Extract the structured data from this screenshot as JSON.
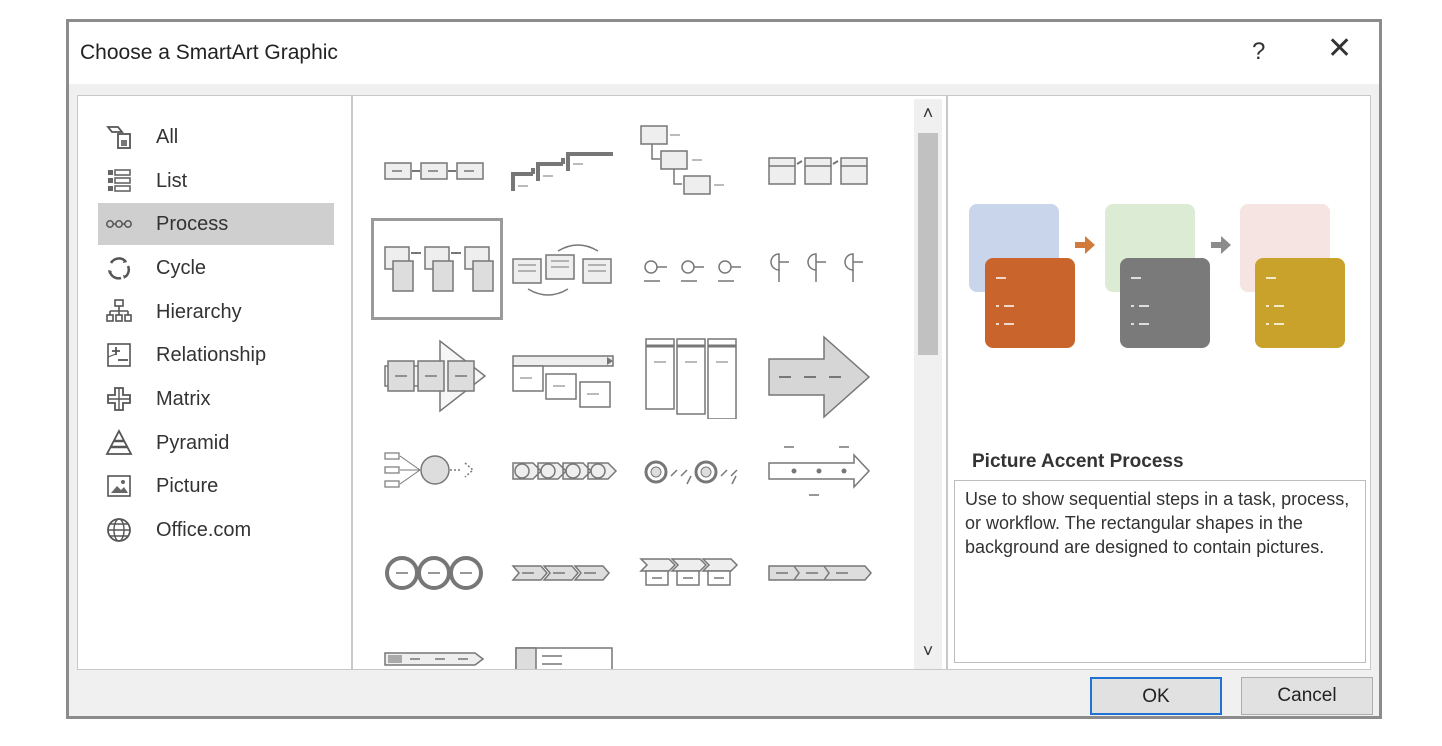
{
  "dialog": {
    "title": "Choose a SmartArt Graphic",
    "help_label": "?",
    "close_label": "✕"
  },
  "categories": [
    {
      "label": "All",
      "icon": "all-icon"
    },
    {
      "label": "List",
      "icon": "list-icon"
    },
    {
      "label": "Process",
      "icon": "process-icon",
      "selected": true
    },
    {
      "label": "Cycle",
      "icon": "cycle-icon"
    },
    {
      "label": "Hierarchy",
      "icon": "hierarchy-icon"
    },
    {
      "label": "Relationship",
      "icon": "relationship-icon"
    },
    {
      "label": "Matrix",
      "icon": "matrix-icon"
    },
    {
      "label": "Pyramid",
      "icon": "pyramid-icon"
    },
    {
      "label": "Picture",
      "icon": "picture-icon"
    },
    {
      "label": "Office.com",
      "icon": "globe-icon"
    }
  ],
  "scroll": {
    "up": "˄",
    "down": "˅"
  },
  "preview": {
    "title": "Picture Accent Process",
    "description": "Use to show sequential steps in a task, process, or workflow. The rectangular shapes in the background are designed to contain pictures.",
    "colors": {
      "bg1": "#c9d5ea",
      "fg1": "#c8642c",
      "bg2": "#dcebd4",
      "fg2": "#7a7a7a",
      "bg3": "#f6e4e2",
      "fg3": "#c9a22c",
      "arrow1": "#d07a3c",
      "arrow2": "#8c8c8c"
    }
  },
  "buttons": {
    "ok": "OK",
    "cancel": "Cancel"
  }
}
